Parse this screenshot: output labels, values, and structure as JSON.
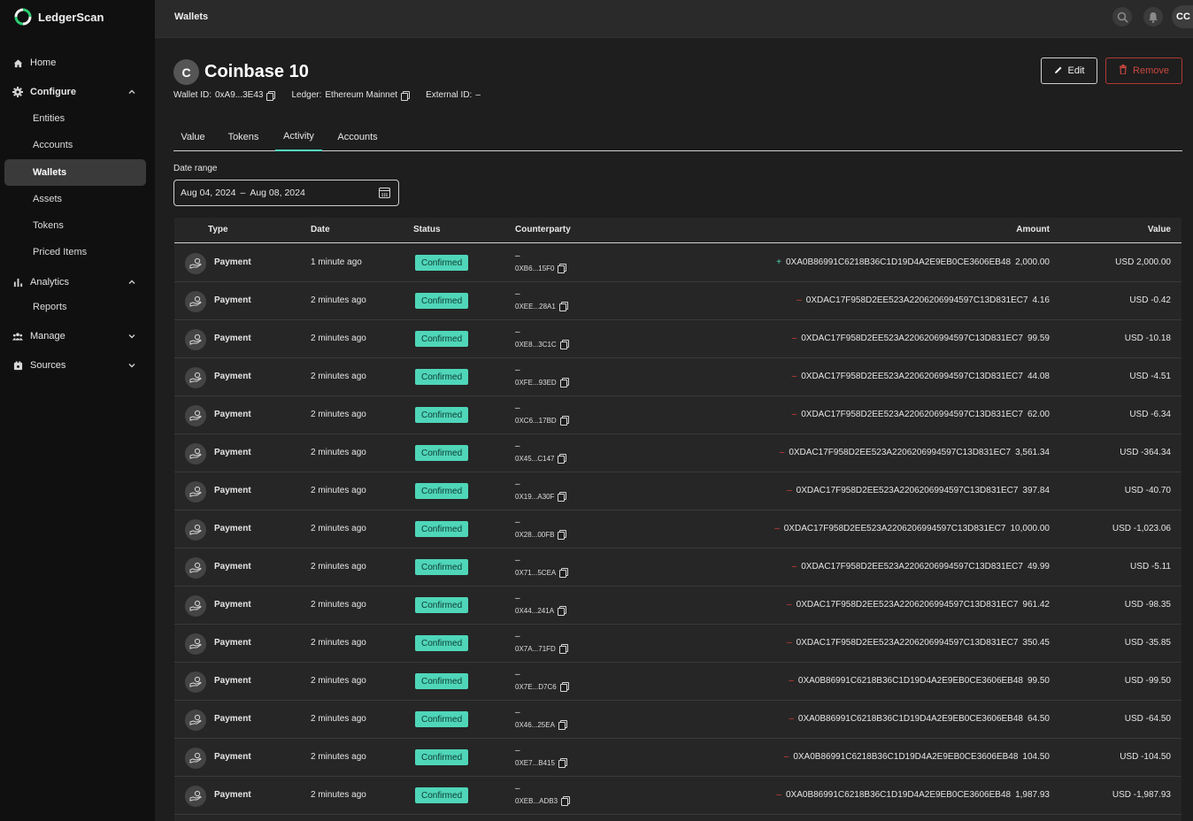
{
  "app": {
    "name": "LedgerScan"
  },
  "sidebar": {
    "home": "Home",
    "configure": "Configure",
    "configure_items": [
      "Entities",
      "Accounts",
      "Wallets",
      "Assets",
      "Tokens",
      "Priced Items"
    ],
    "analytics": "Analytics",
    "analytics_items": [
      "Reports"
    ],
    "manage": "Manage",
    "sources": "Sources"
  },
  "topbar": {
    "title": "Wallets",
    "avatar_initials": "CC"
  },
  "wallet": {
    "avatar_letter": "C",
    "title": "Coinbase 10",
    "wallet_id_label": "Wallet ID:",
    "wallet_id": "0xA9...3E43",
    "ledger_label": "Ledger:",
    "ledger": "Ethereum Mainnet",
    "external_id_label": "External ID:",
    "external_id": "–"
  },
  "actions": {
    "edit": "Edit",
    "remove": "Remove"
  },
  "tabs": [
    "Value",
    "Tokens",
    "Activity",
    "Accounts"
  ],
  "active_tab": "Activity",
  "date_range": {
    "label": "Date range",
    "start": "Aug 04, 2024",
    "sep": "–",
    "end": "Aug 08, 2024"
  },
  "table": {
    "headers": {
      "type": "Type",
      "date": "Date",
      "status": "Status",
      "counterparty": "Counterparty",
      "amount": "Amount",
      "value": "Value"
    },
    "rows": [
      {
        "type": "Payment",
        "date": "1 minute ago",
        "status": "Confirmed",
        "cp_name": "–",
        "cp_addr": "0XB6...15F0",
        "sign": "+",
        "token": "0XA0B86991C6218B36C1D19D4A2E9EB0CE3606EB48",
        "amount": "2,000.00",
        "value": "USD  2,000.00"
      },
      {
        "type": "Payment",
        "date": "2 minutes ago",
        "status": "Confirmed",
        "cp_name": "–",
        "cp_addr": "0XEE...28A1",
        "sign": "–",
        "token": "0XDAC17F958D2EE523A2206206994597C13D831EC7",
        "amount": "4.16",
        "value": "USD  -0.42"
      },
      {
        "type": "Payment",
        "date": "2 minutes ago",
        "status": "Confirmed",
        "cp_name": "–",
        "cp_addr": "0XE8...3C1C",
        "sign": "–",
        "token": "0XDAC17F958D2EE523A2206206994597C13D831EC7",
        "amount": "99.59",
        "value": "USD  -10.18"
      },
      {
        "type": "Payment",
        "date": "2 minutes ago",
        "status": "Confirmed",
        "cp_name": "–",
        "cp_addr": "0XFE...93ED",
        "sign": "–",
        "token": "0XDAC17F958D2EE523A2206206994597C13D831EC7",
        "amount": "44.08",
        "value": "USD  -4.51"
      },
      {
        "type": "Payment",
        "date": "2 minutes ago",
        "status": "Confirmed",
        "cp_name": "–",
        "cp_addr": "0XC6...17BD",
        "sign": "–",
        "token": "0XDAC17F958D2EE523A2206206994597C13D831EC7",
        "amount": "62.00",
        "value": "USD  -6.34"
      },
      {
        "type": "Payment",
        "date": "2 minutes ago",
        "status": "Confirmed",
        "cp_name": "–",
        "cp_addr": "0X45...C147",
        "sign": "–",
        "token": "0XDAC17F958D2EE523A2206206994597C13D831EC7",
        "amount": "3,561.34",
        "value": "USD  -364.34"
      },
      {
        "type": "Payment",
        "date": "2 minutes ago",
        "status": "Confirmed",
        "cp_name": "–",
        "cp_addr": "0X19...A30F",
        "sign": "–",
        "token": "0XDAC17F958D2EE523A2206206994597C13D831EC7",
        "amount": "397.84",
        "value": "USD  -40.70"
      },
      {
        "type": "Payment",
        "date": "2 minutes ago",
        "status": "Confirmed",
        "cp_name": "–",
        "cp_addr": "0X28...00FB",
        "sign": "–",
        "token": "0XDAC17F958D2EE523A2206206994597C13D831EC7",
        "amount": "10,000.00",
        "value": "USD  -1,023.06"
      },
      {
        "type": "Payment",
        "date": "2 minutes ago",
        "status": "Confirmed",
        "cp_name": "–",
        "cp_addr": "0X71...5CEA",
        "sign": "–",
        "token": "0XDAC17F958D2EE523A2206206994597C13D831EC7",
        "amount": "49.99",
        "value": "USD  -5.11"
      },
      {
        "type": "Payment",
        "date": "2 minutes ago",
        "status": "Confirmed",
        "cp_name": "–",
        "cp_addr": "0X44...241A",
        "sign": "–",
        "token": "0XDAC17F958D2EE523A2206206994597C13D831EC7",
        "amount": "961.42",
        "value": "USD  -98.35"
      },
      {
        "type": "Payment",
        "date": "2 minutes ago",
        "status": "Confirmed",
        "cp_name": "–",
        "cp_addr": "0X7A...71FD",
        "sign": "–",
        "token": "0XDAC17F958D2EE523A2206206994597C13D831EC7",
        "amount": "350.45",
        "value": "USD  -35.85"
      },
      {
        "type": "Payment",
        "date": "2 minutes ago",
        "status": "Confirmed",
        "cp_name": "–",
        "cp_addr": "0X7E...D7C6",
        "sign": "–",
        "token": "0XA0B86991C6218B36C1D19D4A2E9EB0CE3606EB48",
        "amount": "99.50",
        "value": "USD  -99.50"
      },
      {
        "type": "Payment",
        "date": "2 minutes ago",
        "status": "Confirmed",
        "cp_name": "–",
        "cp_addr": "0X46...25EA",
        "sign": "–",
        "token": "0XA0B86991C6218B36C1D19D4A2E9EB0CE3606EB48",
        "amount": "64.50",
        "value": "USD  -64.50"
      },
      {
        "type": "Payment",
        "date": "2 minutes ago",
        "status": "Confirmed",
        "cp_name": "–",
        "cp_addr": "0XE7...B415",
        "sign": "–",
        "token": "0XA0B86991C6218B36C1D19D4A2E9EB0CE3606EB48",
        "amount": "104.50",
        "value": "USD  -104.50"
      },
      {
        "type": "Payment",
        "date": "2 minutes ago",
        "status": "Confirmed",
        "cp_name": "–",
        "cp_addr": "0XEB...ADB3",
        "sign": "–",
        "token": "0XA0B86991C6218B36C1D19D4A2E9EB0CE3606EB48",
        "amount": "1,987.93",
        "value": "USD  -1,987.93"
      }
    ]
  },
  "colors": {
    "accent": "#4fe0c0",
    "badge_bg": "#4fd6b9",
    "positive": "#4fd6b9",
    "negative": "#d9413b",
    "remove": "#c9473f"
  },
  "icons": {
    "home": "home-icon",
    "configure": "gear-icon",
    "analytics": "bar-chart-icon",
    "manage": "users-icon",
    "sources": "database-icon",
    "search": "search-icon",
    "bell": "bell-icon",
    "edit": "pencil-icon",
    "remove": "trash-icon",
    "calendar": "calendar-icon",
    "copy": "copy-icon",
    "payment": "hand-coin-icon"
  }
}
